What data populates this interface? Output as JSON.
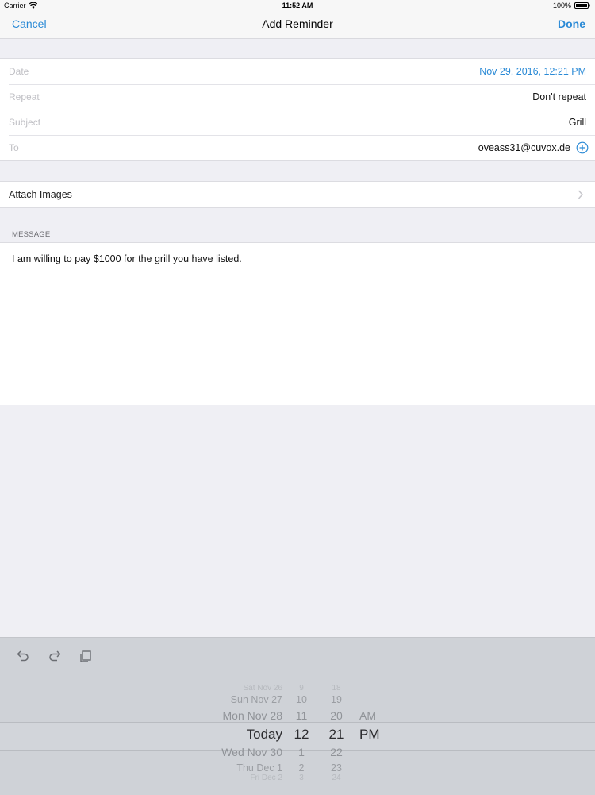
{
  "status_bar": {
    "carrier": "Carrier",
    "wifi_icon": "wifi-icon",
    "time": "11:52 AM",
    "battery": "100%",
    "battery_icon": "battery-icon"
  },
  "nav": {
    "cancel": "Cancel",
    "title": "Add Reminder",
    "done": "Done",
    "accent_color": "#2a8ad6"
  },
  "form": {
    "date": {
      "label": "Date",
      "value": "Nov 29, 2016, 12:21 PM"
    },
    "repeat": {
      "label": "Repeat",
      "value": "Don't repeat"
    },
    "subject": {
      "label": "Subject",
      "value": "Grill"
    },
    "to": {
      "label": "To",
      "value": "oveass31@cuvox.de",
      "add_icon": "add-circle-icon"
    }
  },
  "attach": {
    "label": "Attach Images",
    "icon": "chevron-right-icon"
  },
  "message": {
    "header": "MESSAGE",
    "text": "I am willing to pay $1000 for the grill you have listed."
  },
  "toolbar": {
    "undo_icon": "undo-icon",
    "redo_icon": "redo-icon",
    "paste_icon": "paste-icon"
  },
  "picker": {
    "dates": [
      "Sat Nov 26",
      "Sun Nov 27",
      "Mon Nov 28",
      "Today",
      "Wed Nov 30",
      "Thu Dec 1",
      "Fri Dec 2"
    ],
    "hours": [
      "9",
      "10",
      "11",
      "12",
      "1",
      "2",
      "3"
    ],
    "minutes": [
      "18",
      "19",
      "20",
      "21",
      "22",
      "23",
      "24"
    ],
    "ampm": [
      "AM",
      "PM"
    ],
    "selected_index": 3,
    "selected_ampm_index": 1
  }
}
